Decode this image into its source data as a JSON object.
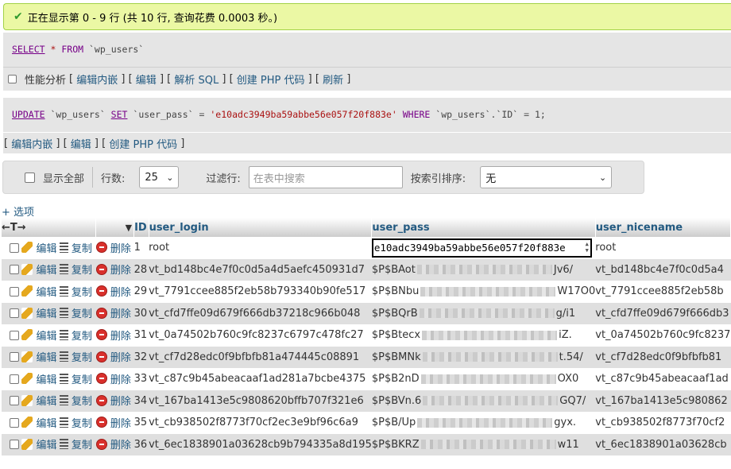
{
  "success_message": "正在显示第 0 - 9 行 (共 10 行, 查询花费 0.0003 秒。)",
  "query1": {
    "select": "SELECT",
    "star": "*",
    "from": "FROM",
    "table": "`wp_users`"
  },
  "options": {
    "profiling": "性能分析",
    "links": [
      "编辑内嵌",
      "编辑",
      "解析 SQL",
      "创建 PHP 代码",
      "刷新"
    ]
  },
  "query2": {
    "update": "UPDATE",
    "table": "`wp_users`",
    "set": "SET",
    "col": "`user_pass`",
    "eq": "=",
    "value": "'e10adc3949ba59abbe56e057f20f883e'",
    "where": "WHERE",
    "cond": "`wp_users`.`ID`",
    "eq2": "=",
    "num": "1;"
  },
  "update_links": [
    "编辑内嵌",
    "编辑",
    "创建 PHP 代码"
  ],
  "nav": {
    "show_all": "显示全部",
    "rows_label": "行数:",
    "rows_value": "25",
    "filter_label": "过滤行:",
    "filter_placeholder": "在表中搜索",
    "sort_label": "按索引排序:",
    "sort_value": "无"
  },
  "options_toggle": "+ 选项",
  "columns": {
    "id": "ID",
    "user_login": "user_login",
    "user_pass": "user_pass",
    "user_nicename": "user_nicename"
  },
  "actions": {
    "edit": "编辑",
    "copy": "复制",
    "delete": "删除"
  },
  "rows": [
    {
      "id": "1",
      "login": "root",
      "pass_start": "e10adc3949ba59abbe56e057f20f883e",
      "pass_end": "",
      "nicename": "root"
    },
    {
      "id": "28",
      "login": "vt_bd148bc4e7f0c0d5a4d5aefc450931d7",
      "pass_start": "$P$BAot",
      "pass_end": "Jv6/",
      "nicename": "vt_bd148bc4e7f0c0d5a4"
    },
    {
      "id": "29",
      "login": "vt_7791ccee885f2eb58b793340b90fe517",
      "pass_start": "$P$BNbu",
      "pass_end": "W17O0",
      "nicename": "vt_7791ccee885f2eb58b"
    },
    {
      "id": "30",
      "login": "vt_cfd7ffe09d679f666db37218c966b048",
      "pass_start": "$P$BQrB",
      "pass_end": "g/i1",
      "nicename": "vt_cfd7ffe09d679f666db3"
    },
    {
      "id": "31",
      "login": "vt_0a74502b760c9fc8237c6797c478fc27",
      "pass_start": "$P$Btecx",
      "pass_end": "iZ.",
      "nicename": "vt_0a74502b760c9fc8237"
    },
    {
      "id": "32",
      "login": "vt_cf7d28edc0f9bfbfb81a474445c08891",
      "pass_start": "$P$BMNk",
      "pass_end": "t.54/",
      "nicename": "vt_cf7d28edc0f9bfbfb81"
    },
    {
      "id": "33",
      "login": "vt_c87c9b45abeacaaf1ad281a7bcbe4375",
      "pass_start": "$P$B2nD",
      "pass_end": "OX0",
      "nicename": "vt_c87c9b45abeacaaf1ad"
    },
    {
      "id": "34",
      "login": "vt_167ba1413e5c9808620bffb707f321e6",
      "pass_start": "$P$BVn.6",
      "pass_end": "GQ7/",
      "nicename": "vt_167ba1413e5c980862"
    },
    {
      "id": "35",
      "login": "vt_cb938502f8773f70cf2ec3e9bf96c6a9",
      "pass_start": "$P$B/Up",
      "pass_end": "gyx.",
      "nicename": "vt_cb938502f8773f70cf2"
    },
    {
      "id": "36",
      "login": "vt_6ec1838901a03628cb9b794335a8d195",
      "pass_start": "$P$BKRZ",
      "pass_end": "w11",
      "nicename": "vt_6ec1838901a03628cb"
    }
  ]
}
